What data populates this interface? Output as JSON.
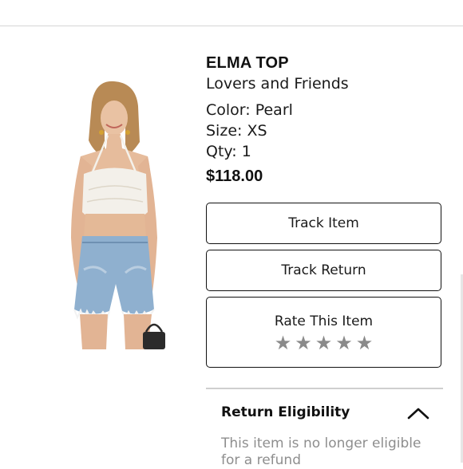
{
  "product": {
    "title": "ELMA TOP",
    "brand": "Lovers and Friends",
    "color": "Color: Pearl",
    "size": "Size: XS",
    "qty": "Qty: 1",
    "price": "$118.00"
  },
  "actions": {
    "track_item": "Track Item",
    "track_return": "Track Return",
    "rate_item": "Rate This Item"
  },
  "rating": {
    "stars": [
      "★",
      "★",
      "★",
      "★",
      "★"
    ],
    "value": 0,
    "max": 5,
    "star_color": "#8a8a8a"
  },
  "return_eligibility": {
    "title": "Return Eligibility",
    "message": "This item is no longer eligible for a refund"
  },
  "icons": {
    "chevron": "chevron-up-icon"
  }
}
